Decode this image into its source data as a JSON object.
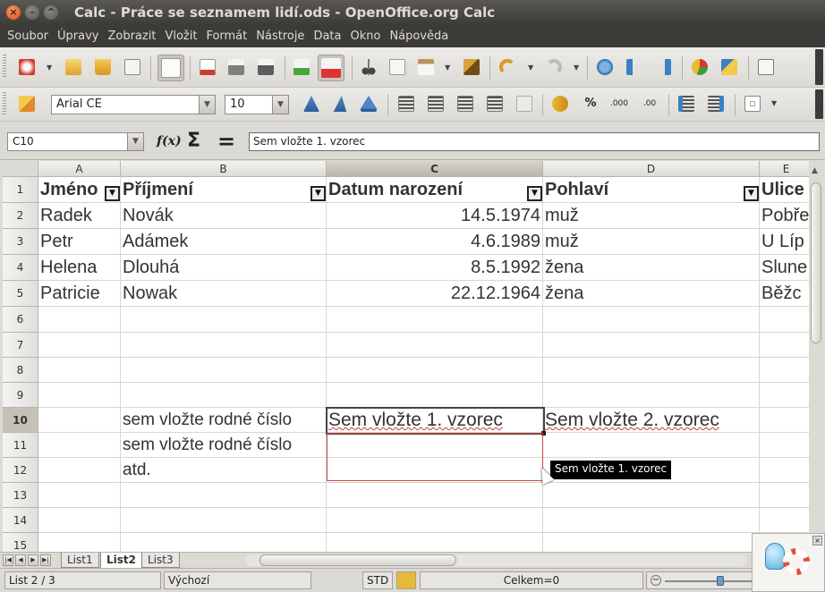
{
  "window": {
    "title": "Calc - Práce se seznamem lidí.ods - OpenOffice.org Calc"
  },
  "menu": [
    "Soubor",
    "Úpravy",
    "Zobrazit",
    "Vložit",
    "Formát",
    "Nástroje",
    "Data",
    "Okno",
    "Nápověda"
  ],
  "formatting": {
    "font_name": "Arial CE",
    "font_size": "10"
  },
  "formula_bar": {
    "name_box": "C10",
    "fx_label": "f(x)",
    "sum_label": "Σ",
    "equals_label": "=",
    "content": "Sem vložte 1. vzorec"
  },
  "columns": [
    "A",
    "B",
    "C",
    "D",
    "E"
  ],
  "rows": [
    "1",
    "2",
    "3",
    "4",
    "5",
    "6",
    "7",
    "8",
    "9",
    "10",
    "11",
    "12",
    "13",
    "14",
    "15"
  ],
  "sheet": {
    "headers": [
      "Jméno",
      "Příjmení",
      "Datum narození",
      "Pohlaví",
      "Ulice"
    ],
    "data": [
      [
        "Radek",
        "Novák",
        "14.5.1974",
        "muž",
        "Pobře"
      ],
      [
        "Petr",
        "Adámek",
        "4.6.1989",
        "muž",
        "U Líp"
      ],
      [
        "Helena",
        "Dlouhá",
        "8.5.1992",
        "žena",
        "Slune"
      ],
      [
        "Patricie",
        "Nowak",
        "22.12.1964",
        "žena",
        "Běžc"
      ]
    ],
    "b10": "sem vložte rodné číslo",
    "b11": "sem vložte rodné číslo",
    "b12": "atd.",
    "c10": "Sem vložte 1. vzorec",
    "d10": "Sem vložte 2. vzorec"
  },
  "tooltip": "Sem vložte 1. vzorec",
  "tabs": [
    "List1",
    "List2",
    "List3"
  ],
  "active_tab": "List2",
  "status": {
    "sheet": "List 2 / 3",
    "style": "Výchozí",
    "mode": "STD",
    "sum": "Celkem=0"
  },
  "colors": {
    "title_bg": "#3c3b37",
    "close_button": "#df4a16",
    "selection_border": "#d04545",
    "toolbar_bg": "#dcdad5"
  }
}
